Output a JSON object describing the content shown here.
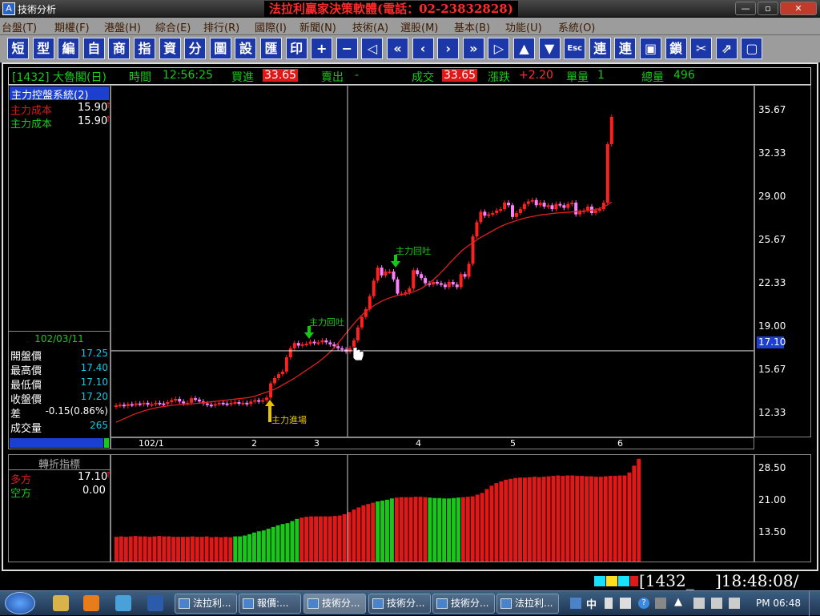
{
  "window": {
    "icon_glyph": "A",
    "title": "技術分析",
    "brand": "法拉利贏家決策軟體(電話：02-23832828)",
    "ctrl_min": "—",
    "ctrl_max": "▫",
    "ctrl_close": "✕"
  },
  "menu": [
    "台盤(T)",
    "期權(F)",
    "港盤(H)",
    "綜合(E)",
    "排行(R)",
    "國際(I)",
    "新聞(N)",
    "技術(A)",
    "選股(M)",
    "基本(B)",
    "功能(U)",
    "系統(O)"
  ],
  "toolbar": [
    "短",
    "型",
    "編",
    "自",
    "商",
    "指",
    "資",
    "分",
    "圖",
    "設",
    "匯",
    "印",
    "+",
    "−",
    "◁",
    "«",
    "‹",
    "›",
    "»",
    "▷",
    "▲",
    "▼",
    "Esc",
    "連",
    "連",
    "▣",
    "鎖",
    "✂",
    "⇗",
    "▢"
  ],
  "quote": {
    "code": "[1432] 大魯閣(日)",
    "time_label": "時間",
    "time": "12:56:25",
    "bid_label": "買進",
    "bid": "33.65",
    "ask_label": "賣出",
    "ask": "-",
    "deal_label": "成交",
    "deal": "33.65",
    "chg_label": "漲跌",
    "chg": "+2.20",
    "vol_label": "單量",
    "vol": "1",
    "tvol_label": "總量",
    "tvol": "496"
  },
  "left": {
    "system": "主力控盤系統(2)",
    "l1": "主力成本",
    "v1": "15.90",
    "l2": "主力成本",
    "v2": "15.90",
    "arrow": "↑",
    "date": "102/03/11",
    "rows": [
      {
        "k": "開盤價",
        "v": "17.25"
      },
      {
        "k": "最高價",
        "v": "17.40"
      },
      {
        "k": "最低價",
        "v": "17.10"
      },
      {
        "k": "收盤價",
        "v": "17.20"
      },
      {
        "k": "差",
        "v": "-0.15(0.86%)"
      },
      {
        "k": "成交量",
        "v": "265"
      }
    ]
  },
  "indicator": {
    "title": "轉折指標",
    "l1": "多方",
    "v1": "17.10",
    "arrow": "↑",
    "l2": "空方",
    "v2": "0.00"
  },
  "annotations": {
    "entry": "主力進場",
    "spit1": "主力回吐",
    "spit2": "主力回吐"
  },
  "colors": {
    "up": "#ff2020",
    "down": "#ff80ff",
    "ma": "#e02020",
    "bull": "#e01818",
    "bear": "#18c818",
    "info_green": "#18c818",
    "highlight": "#e01818"
  },
  "statusbar": {
    "code": "[1432_",
    "clock": "]18:48:08/"
  },
  "taskbar": {
    "start": "Start",
    "items": [
      "法拉利...",
      "報價:...",
      "技術分...",
      "技術分...",
      "技術分...",
      "法拉利..."
    ],
    "tray_ime": "中",
    "tray_time": "PM 06:48"
  },
  "chart_data": [
    {
      "type": "candlestick",
      "title": "1432 大魯閣(日)",
      "y_ticks": [
        35.67,
        32.33,
        29.0,
        25.67,
        22.33,
        19.0,
        15.67,
        12.33
      ],
      "ylim": [
        10.5,
        37.5
      ],
      "cursor_value": "17.10",
      "x_ticks": [
        "102/1",
        "2",
        "3",
        "4",
        "5",
        "6"
      ],
      "closes": [
        12.9,
        12.95,
        12.85,
        13.0,
        12.95,
        13.05,
        13.0,
        13.1,
        12.95,
        13.0,
        13.1,
        13.05,
        13.0,
        13.15,
        13.3,
        13.4,
        13.2,
        13.05,
        13.1,
        13.45,
        13.35,
        13.2,
        13.05,
        12.95,
        12.9,
        13.0,
        13.1,
        13.05,
        13.0,
        13.1,
        13.15,
        13.05,
        13.1,
        13.0,
        13.2,
        13.3,
        13.2,
        13.3,
        13.5,
        14.6,
        15.0,
        15.3,
        15.5,
        16.6,
        17.3,
        17.7,
        17.5,
        17.6,
        17.65,
        17.8,
        17.7,
        17.75,
        17.9,
        17.75,
        17.6,
        17.45,
        17.3,
        17.2,
        17.05,
        17.3,
        17.9,
        18.9,
        19.7,
        20.3,
        21.3,
        22.5,
        23.5,
        22.9,
        23.2,
        23.2,
        22.6,
        21.5,
        21.5,
        21.6,
        21.9,
        23.3,
        23.0,
        22.7,
        22.3,
        22.2,
        22.4,
        22.3,
        22.2,
        22.0,
        22.4,
        22.2,
        22.0,
        23.0,
        22.8,
        23.8,
        25.9,
        27.0,
        27.8,
        27.5,
        27.6,
        27.7,
        27.9,
        28.0,
        28.5,
        28.3,
        27.4,
        27.7,
        28.0,
        28.4,
        28.6,
        28.7,
        28.3,
        28.5,
        28.2,
        28.3,
        28.0,
        28.4,
        28.3,
        28.1,
        28.4,
        28.5,
        27.6,
        27.8,
        27.9,
        28.2,
        27.7,
        27.9,
        28.0,
        28.5,
        33.0,
        35.1
      ],
      "ma": [
        11.6,
        11.8,
        12.0,
        12.2,
        12.35,
        12.5,
        12.62,
        12.72,
        12.8,
        12.86,
        12.92,
        12.96,
        13.0,
        13.02,
        13.05,
        13.1,
        13.15,
        13.2,
        13.25,
        13.3,
        13.35,
        13.4,
        13.45,
        13.5,
        13.6,
        13.75,
        13.9,
        14.05,
        14.25,
        14.5,
        14.75,
        15.0,
        15.3,
        15.6,
        15.9,
        16.2,
        16.55,
        16.95,
        17.4,
        17.95,
        18.5,
        19.05,
        19.55,
        20.0,
        20.35,
        20.65,
        20.9,
        21.1,
        21.25,
        21.38,
        21.45,
        21.55,
        21.7,
        21.9,
        22.2,
        22.55,
        22.95,
        23.4,
        23.9,
        24.35,
        24.8,
        25.15,
        25.45,
        25.75,
        26.0,
        26.25,
        26.5,
        26.72,
        26.9,
        27.05,
        27.2,
        27.32,
        27.42,
        27.5,
        27.58,
        27.62,
        27.68,
        27.72,
        27.75,
        27.78,
        27.82,
        27.85,
        27.9,
        27.95,
        28.05,
        28.25,
        28.55
      ]
    },
    {
      "type": "bar",
      "title": "轉折指標",
      "y_ticks": [
        28.5,
        21.0,
        13.5
      ],
      "ylim": [
        6.5,
        31.5
      ],
      "values": [
        12.3,
        12.4,
        12.3,
        12.4,
        12.5,
        12.4,
        12.4,
        12.3,
        12.4,
        12.5,
        12.4,
        12.4,
        12.3,
        12.3,
        12.3,
        12.3,
        12.4,
        12.3,
        12.3,
        12.4,
        12.2,
        12.3,
        12.2,
        12.3,
        12.2,
        12.4,
        12.4,
        12.6,
        12.9,
        13.3,
        13.6,
        13.8,
        14.2,
        14.6,
        15.0,
        15.3,
        15.5,
        16.0,
        16.5,
        16.8,
        17.0,
        17.1,
        17.1,
        17.1,
        17.1,
        17.1,
        17.2,
        17.3,
        17.6,
        18.1,
        18.7,
        19.2,
        19.7,
        20.0,
        20.3,
        20.6,
        20.8,
        21.0,
        21.3,
        21.5,
        21.6,
        21.6,
        21.6,
        21.7,
        21.7,
        21.6,
        21.5,
        21.4,
        21.4,
        21.3,
        21.3,
        21.4,
        21.5,
        21.6,
        21.7,
        21.8,
        22.2,
        22.6,
        23.5,
        24.3,
        24.9,
        25.3,
        25.7,
        25.9,
        26.1,
        26.2,
        26.2,
        26.3,
        26.4,
        26.3,
        26.4,
        26.5,
        26.6,
        26.7,
        26.6,
        26.7,
        26.7,
        26.6,
        26.6,
        26.5,
        26.5,
        26.4,
        26.4,
        26.5,
        26.6,
        26.6,
        26.7,
        26.7,
        27.4,
        29.0,
        30.6
      ],
      "bear_ranges": [
        [
          25,
          38
        ],
        [
          55,
          58
        ],
        [
          66,
          72
        ],
        [
          122,
          125
        ],
        [
          129,
          133
        ],
        [
          135,
          135
        ]
      ]
    }
  ]
}
